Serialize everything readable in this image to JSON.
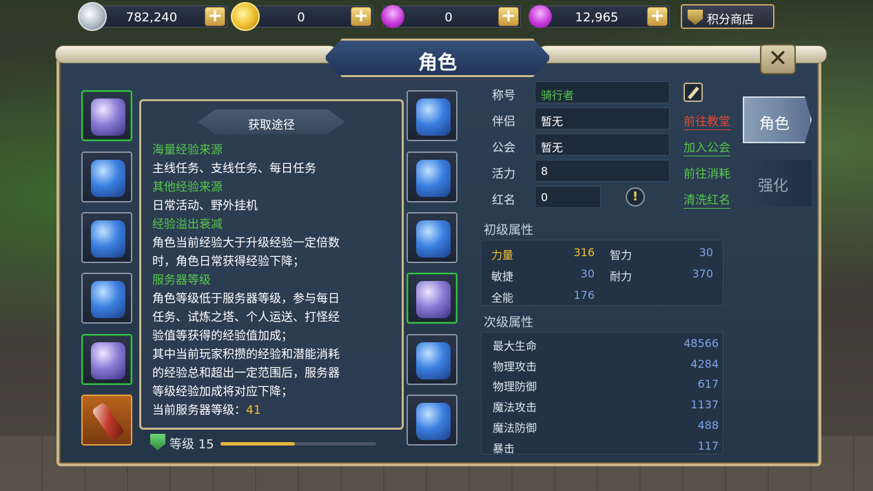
{
  "currencies": [
    {
      "icon": "silver-coin-icon",
      "value": "782,240"
    },
    {
      "icon": "gold-coin-icon",
      "value": "0"
    },
    {
      "icon": "bound-gem-icon",
      "value": "0"
    },
    {
      "icon": "gem-icon",
      "value": "12,965"
    }
  ],
  "plus_label": "+",
  "shop_label": "积分商店",
  "title": "角色",
  "close_label": "✕",
  "popup": {
    "title": "获取途径",
    "lines": [
      {
        "text": "海量经验来源",
        "style": "head"
      },
      {
        "text": "主线任务、支线任务、每日任务",
        "style": "body"
      },
      {
        "text": "其他经验来源",
        "style": "head"
      },
      {
        "text": "日常活动、野外挂机",
        "style": "body"
      },
      {
        "text": "经验溢出衰减",
        "style": "head"
      },
      {
        "text": "角色当前经验大于升级经验一定倍数",
        "style": "body"
      },
      {
        "text": "时，角色日常获得经验下降；",
        "style": "body"
      },
      {
        "text": "服务器等级",
        "style": "head"
      },
      {
        "text": "角色等级低于服务器等级，参与每日",
        "style": "body"
      },
      {
        "text": "任务、试炼之塔、个人运送、打怪经",
        "style": "body"
      },
      {
        "text": "验值等获得的经验值加成；",
        "style": "body"
      },
      {
        "text": "其中当前玩家积攒的经验和潜能消耗",
        "style": "body"
      },
      {
        "text": "的经验总和超出一定范围后，服务器",
        "style": "body"
      },
      {
        "text": "等级经验加成将对应下降；",
        "style": "body"
      }
    ],
    "server_level_label": "当前服务器等级：",
    "server_level_value": "41"
  },
  "level": {
    "label": "等级 15",
    "progress": 0.48
  },
  "info": {
    "title_label": "称号",
    "title_value": "骑行者",
    "partner_label": "伴侣",
    "partner_value": "暂无",
    "partner_link": "前往教堂",
    "guild_label": "公会",
    "guild_value": "暂无",
    "guild_link": "加入公会",
    "vigor_label": "活力",
    "vigor_value": "8",
    "vigor_link": "前往消耗",
    "red_label": "红名",
    "red_value": "0",
    "red_link": "清洗红名"
  },
  "primary": {
    "title": "初级属性",
    "attrs": [
      {
        "name": "力量",
        "value": "316"
      },
      {
        "name": "智力",
        "value": "30"
      },
      {
        "name": "敏捷",
        "value": "30"
      },
      {
        "name": "耐力",
        "value": "370"
      },
      {
        "name": "全能",
        "value": "176"
      }
    ]
  },
  "secondary": {
    "title": "次级属性",
    "attrs": [
      {
        "name": "最大生命",
        "value": "48566"
      },
      {
        "name": "物理攻击",
        "value": "4284"
      },
      {
        "name": "物理防御",
        "value": "617"
      },
      {
        "name": "魔法攻击",
        "value": "1137"
      },
      {
        "name": "魔法防御",
        "value": "488"
      },
      {
        "name": "暴击",
        "value": "117"
      }
    ]
  },
  "tabs": [
    {
      "label": "角色",
      "active": true
    },
    {
      "label": "强化",
      "active": false
    }
  ],
  "colors": {
    "accent_gold": "#c9b68a",
    "green_text": "#55c84a",
    "red_link": "#e04a3a",
    "value_blue": "#7fa6e6"
  }
}
